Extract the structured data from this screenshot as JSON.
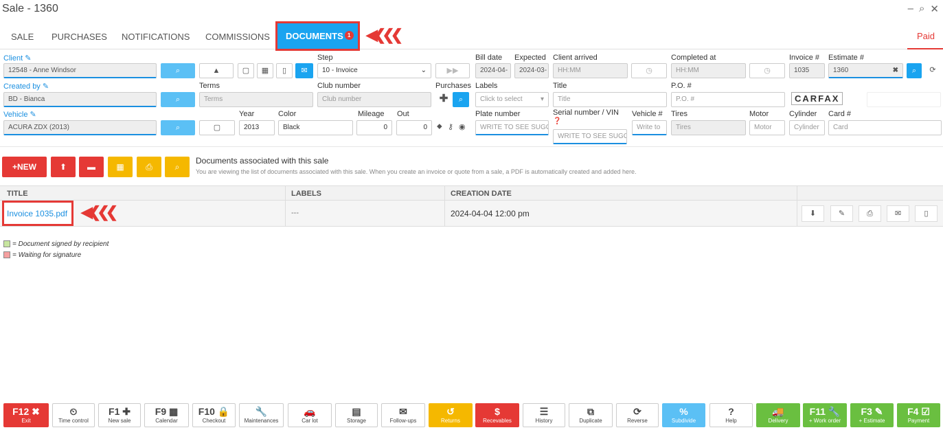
{
  "window": {
    "title": "Sale - 1360",
    "minimize": "–",
    "chat": "⌕",
    "close": "✕"
  },
  "tabs": [
    {
      "label": "SALE"
    },
    {
      "label": "PURCHASES"
    },
    {
      "label": "NOTIFICATIONS"
    },
    {
      "label": "COMMISSIONS"
    },
    {
      "label": "DOCUMENTS",
      "badge": "1"
    }
  ],
  "status": "Paid",
  "form": {
    "client_label": "Client",
    "client_value": "12548 - Anne Windsor",
    "created_by_label": "Created by",
    "created_by_value": "BD - Bianca",
    "vehicle_label": "Vehicle",
    "vehicle_value": "ACURA ZDX (2013)",
    "step_label": "Step",
    "step_value": "10 - Invoice",
    "terms_label": "Terms",
    "terms_placeholder": "Terms",
    "club_label": "Club number",
    "club_placeholder": "Club number",
    "year_label": "Year",
    "year_value": "2013",
    "color_label": "Color",
    "color_value": "Black",
    "mileage_label": "Mileage",
    "mileage_value": "0",
    "out_label": "Out",
    "out_value": "0",
    "bill_date_label": "Bill date",
    "bill_date_value": "2024-04-",
    "expected_label": "Expected",
    "expected_value": "2024-03-",
    "client_arrived_label": "Client arrived",
    "client_arrived_placeholder": "HH:MM",
    "completed_label": "Completed at",
    "completed_placeholder": "HH:MM",
    "invoice_label": "Invoice #",
    "invoice_value": "1035",
    "estimate_label": "Estimate #",
    "estimate_value": "1360",
    "purchases_label": "Purchases",
    "labels_label": "Labels",
    "labels_placeholder": "Click to select",
    "title_label": "Title",
    "title_placeholder": "Title",
    "po_label": "P.O. #",
    "po_placeholder": "P.O. #",
    "plate_label": "Plate number",
    "plate_placeholder": "WRITE TO SEE SUGG",
    "serial_label": "Serial number / VIN",
    "serial_placeholder": "WRITE TO SEE SUGG",
    "vehicle_num_label": "Vehicle #",
    "vehicle_num_placeholder": "Write to",
    "tires_label": "Tires",
    "tires_placeholder": "Tires",
    "motor_label": "Motor",
    "motor_placeholder": "Motor",
    "cylinder_label": "Cylinder",
    "cylinder_placeholder": "Cylinder",
    "card_label": "Card #",
    "card_placeholder": "Card",
    "carfax": "CARFAX"
  },
  "toolbar": {
    "new_label": "+NEW"
  },
  "section": {
    "title": "Documents associated with this sale",
    "subtitle": "You are viewing the list of documents associated with this sale. When you create an invoice or quote from a sale, a PDF is automatically created and added here."
  },
  "table": {
    "headers": [
      "TITLE",
      "LABELS",
      "CREATION DATE"
    ],
    "rows": [
      {
        "title": "Invoice 1035.pdf",
        "labels": "---",
        "date": "2024-04-04 12:00 pm"
      }
    ]
  },
  "legend": {
    "signed": "= Document signed by recipient",
    "waiting": "= Waiting for signature"
  },
  "fkeys": [
    {
      "key": "F12 ✖",
      "label": "Exit"
    },
    {
      "key": "⏲",
      "label": "Time control"
    },
    {
      "key": "F1 ✚",
      "label": "New sale"
    },
    {
      "key": "F9 ▦",
      "label": "Calendar"
    },
    {
      "key": "F10 🔒",
      "label": "Checkout"
    },
    {
      "key": "🔧",
      "label": "Maintenances"
    },
    {
      "key": "🚗",
      "label": "Car lot"
    },
    {
      "key": "▤",
      "label": "Storage"
    },
    {
      "key": "✉",
      "label": "Follow-ups"
    },
    {
      "key": "↺",
      "label": "Returns"
    },
    {
      "key": "$",
      "label": "Recevables"
    },
    {
      "key": "☰",
      "label": "History"
    },
    {
      "key": "⧉",
      "label": "Duplicate"
    },
    {
      "key": "⟳",
      "label": "Reverse"
    },
    {
      "key": "%",
      "label": "Subdivide"
    },
    {
      "key": "?",
      "label": "Help"
    },
    {
      "key": "🚚",
      "label": "Delivery"
    },
    {
      "key": "F11 🔧",
      "label": "+ Work order"
    },
    {
      "key": "F3 ✎",
      "label": "+ Estimate"
    },
    {
      "key": "F4 ☑",
      "label": "Payment"
    }
  ]
}
